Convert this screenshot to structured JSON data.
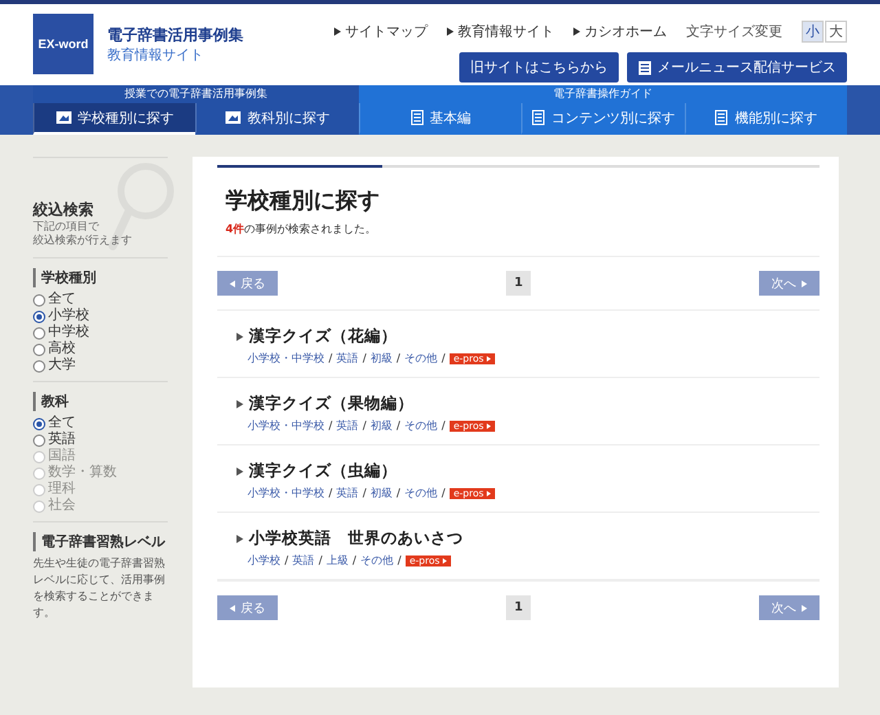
{
  "header": {
    "logo": "EX-word",
    "site_title": "電子辞書活用事例集",
    "site_subtitle": "教育情報サイト",
    "links": [
      "サイトマップ",
      "教育情報サイト",
      "カシオホーム"
    ],
    "font_size": {
      "label": "文字サイズ変更",
      "options": [
        {
          "label": "小",
          "selected": true
        },
        {
          "label": "大",
          "selected": false
        }
      ]
    },
    "buttons": [
      {
        "label": "旧サイトはこちらから",
        "kind": "plain"
      },
      {
        "label": "メールニュース配信サービス",
        "kind": "mail"
      }
    ]
  },
  "nav": {
    "groups": [
      {
        "label": "授業での電子辞書活用事例集",
        "tabs": [
          {
            "label": "学校種別に探す",
            "kind": "case",
            "selected": true
          },
          {
            "label": "教科別に探す",
            "kind": "case",
            "selected": false
          }
        ]
      },
      {
        "label": "電子辞書操作ガイド",
        "tabs": [
          {
            "label": "基本編",
            "kind": "guide",
            "selected": false
          },
          {
            "label": "コンテンツ別に探す",
            "kind": "guide",
            "selected": false
          },
          {
            "label": "機能別に探す",
            "kind": "guide",
            "selected": false
          }
        ]
      }
    ]
  },
  "sidebar": {
    "title": "絞込検索",
    "description": [
      "下記の項目で",
      "絞込検索が行えます"
    ],
    "filters": [
      {
        "title": "学校種別",
        "options": [
          {
            "label": "全て",
            "selected": false,
            "disabled": false
          },
          {
            "label": "小学校",
            "selected": true,
            "disabled": false
          },
          {
            "label": "中学校",
            "selected": false,
            "disabled": false
          },
          {
            "label": "高校",
            "selected": false,
            "disabled": false
          },
          {
            "label": "大学",
            "selected": false,
            "disabled": false
          }
        ]
      },
      {
        "title": "教科",
        "options": [
          {
            "label": "全て",
            "selected": true,
            "disabled": false
          },
          {
            "label": "英語",
            "selected": false,
            "disabled": false
          },
          {
            "label": "国語",
            "selected": false,
            "disabled": true
          },
          {
            "label": "数学・算数",
            "selected": false,
            "disabled": true
          },
          {
            "label": "理科",
            "selected": false,
            "disabled": true
          },
          {
            "label": "社会",
            "selected": false,
            "disabled": true
          }
        ]
      }
    ],
    "level": {
      "title": "電子辞書習熟レベル",
      "description": "先生や生徒の電子辞書習熟レベルに応じて、活用事例を検索することができます。"
    }
  },
  "main": {
    "title": "学校種別に探す",
    "summary": "**4件**の事例が検索されました。",
    "pagination_top": {
      "prev": {
        "label": "戻る",
        "disabled": true
      },
      "pages": [
        {
          "label": "1",
          "selected": true
        }
      ],
      "next": {
        "label": "次へ",
        "disabled": true
      }
    },
    "separator": "/",
    "results": [
      {
        "title": "漢字クイズ（花編）",
        "tags": [
          "小学校・中学校",
          "英語",
          "初級",
          "その他"
        ],
        "badge": "e-pros"
      },
      {
        "title": "漢字クイズ（果物編）",
        "tags": [
          "小学校・中学校",
          "英語",
          "初級",
          "その他"
        ],
        "badge": "e-pros"
      },
      {
        "title": "漢字クイズ（虫編）",
        "tags": [
          "小学校・中学校",
          "英語",
          "初級",
          "その他"
        ],
        "badge": "e-pros"
      },
      {
        "title": "小学校英語　世界のあいさつ",
        "tags": [
          "小学校",
          "英語",
          "上級",
          "その他"
        ],
        "badge": "e-pros"
      }
    ],
    "pagination_bottom": {
      "prev": {
        "label": "戻る",
        "disabled": true
      },
      "pages": [
        {
          "label": "1",
          "selected": true
        }
      ],
      "next": {
        "label": "次へ",
        "disabled": true
      }
    }
  }
}
